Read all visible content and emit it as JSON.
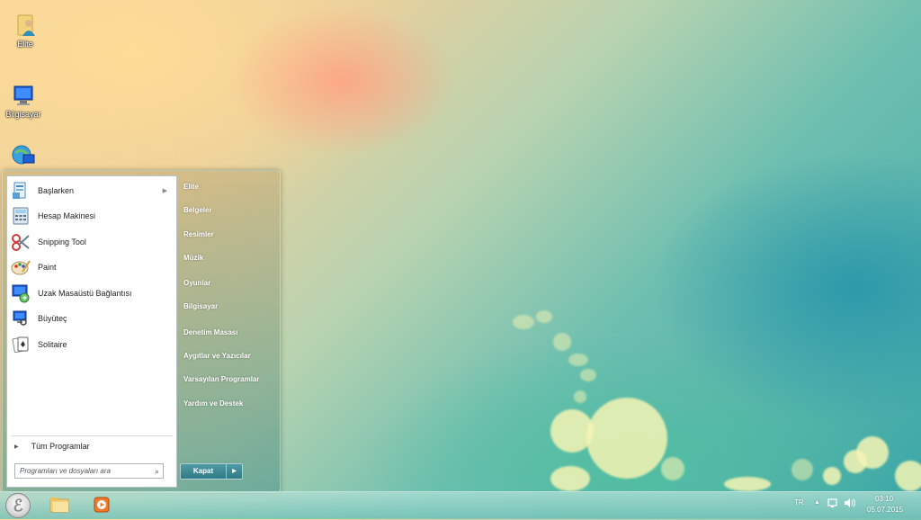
{
  "desktop": {
    "icons": [
      {
        "label": "Elite",
        "icon": "user-folder-icon"
      },
      {
        "label": "Bilgisayar",
        "icon": "computer-icon"
      },
      {
        "label": "",
        "icon": "network-icon"
      }
    ]
  },
  "start_menu": {
    "programs": [
      {
        "label": "Başlarken",
        "icon": "getting-started-icon",
        "has_submenu": true
      },
      {
        "label": "Hesap Makinesi",
        "icon": "calculator-icon"
      },
      {
        "label": "Snipping Tool",
        "icon": "scissors-icon"
      },
      {
        "label": "Paint",
        "icon": "paint-palette-icon"
      },
      {
        "label": "Uzak Masaüstü Bağlantısı",
        "icon": "remote-desktop-icon"
      },
      {
        "label": "Büyüteç",
        "icon": "magnifier-icon"
      },
      {
        "label": "Solitaire",
        "icon": "cards-icon"
      }
    ],
    "all_programs": "Tüm Programlar",
    "search_placeholder": "Programları ve dosyaları ara",
    "right_items": [
      "Elite",
      "Belgeler",
      "Resimler",
      "Müzik",
      "Oyunlar",
      "Bilgisayar",
      "Denetim Masası",
      "Aygıtlar ve Yazıcılar",
      "Varsayılan Programlar",
      "Yardım ve Destek"
    ],
    "shutdown_label": "Kapat"
  },
  "taskbar": {
    "language": "TR",
    "time": "03:10",
    "date": "05.07.2015"
  }
}
